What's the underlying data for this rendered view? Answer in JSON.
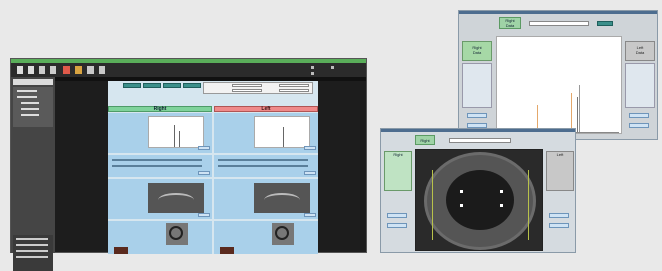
{
  "main_window": {
    "header_right": [
      "Right",
      "Left"
    ],
    "header_left": "Right"
  },
  "top_window": {
    "tab_right": "Right",
    "tab_right_sub": "Data",
    "left_card_title": "Right",
    "left_card_sub": "Data",
    "right_card_title": "Left",
    "right_card_sub": "Data"
  },
  "bottom_window": {
    "tab_right": "Right",
    "left_panel": "Right",
    "right_panel": "Left"
  },
  "colors": {
    "background": "#e9e9e9",
    "title_green": "#5aae5a",
    "panel_blue": "#a9d0ea",
    "right_header": "#7fd39b",
    "left_header": "#ef8a8a",
    "dark_frame": "#1d1d1d"
  }
}
